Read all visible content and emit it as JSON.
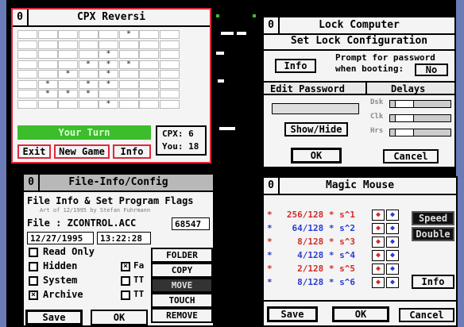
{
  "reversi": {
    "title": "CPX Reversi",
    "close": "0",
    "status": "Your Turn",
    "score_cpx": "CPX: 6",
    "score_you": "You: 18",
    "buttons": {
      "exit": "Exit",
      "new_game": "New Game",
      "info": "Info"
    },
    "board_rows": [
      [
        "",
        "",
        "",
        "",
        "",
        "*",
        "",
        ""
      ],
      [
        "",
        "",
        "",
        "",
        "",
        "",
        "",
        ""
      ],
      [
        "",
        "",
        "",
        "",
        "*",
        "",
        "",
        ""
      ],
      [
        "",
        "",
        "",
        "*",
        "*",
        "*",
        "",
        ""
      ],
      [
        "",
        "",
        "*",
        "",
        "*",
        "",
        "",
        ""
      ],
      [
        "",
        "*",
        "",
        "*",
        "*",
        "",
        "",
        ""
      ],
      [
        "",
        "*",
        "*",
        "*",
        "",
        "",
        "",
        ""
      ],
      [
        "",
        "",
        "",
        "",
        "*",
        "",
        "",
        ""
      ]
    ],
    "colors": {
      "status_bg": "#3cbd2c",
      "border": "#e0283c"
    }
  },
  "lock": {
    "title": "Lock Computer",
    "close": "0",
    "heading": "Set Lock Configuration",
    "info_button": "Info",
    "prompt_line1": "Prompt for password",
    "prompt_line2": "when booting:",
    "prompt_value": "No",
    "edit_password_label": "Edit Password",
    "delays_label": "Delays",
    "show_hide": "Show/Hide",
    "ok": "OK",
    "cancel": "Cancel",
    "delay_rows": [
      {
        "label": "Dsk"
      },
      {
        "label": "Clk"
      },
      {
        "label": "Hrs"
      }
    ]
  },
  "fileinfo": {
    "title": "File-Info/Config",
    "close": "0",
    "heading": "File Info & Set Program Flags",
    "subline": "Art of 12/1995 by Stefan Fuhrmann",
    "file_label": "File : ZCONTROL.ACC",
    "size": "68547",
    "date": "12/27/1995",
    "time": "13:22:28",
    "checks": [
      {
        "label": "Read Only",
        "checked": false
      },
      {
        "label": "Hidden",
        "checked": false
      },
      {
        "label": "System",
        "checked": false
      },
      {
        "label": "Archive",
        "checked": true
      }
    ],
    "right_checks": [
      {
        "label": "Fa",
        "checked": true
      },
      {
        "label": "TT",
        "checked": false
      },
      {
        "label": "TT",
        "checked": false
      }
    ],
    "menu": [
      "FOLDER",
      "COPY",
      "MOVE",
      "TOUCH",
      "REMOVE"
    ],
    "save": "Save",
    "ok": "OK"
  },
  "magic": {
    "title": "Magic Mouse",
    "close": "0",
    "rows": [
      {
        "ratio": "256/128",
        "exp": "s^1",
        "color": "#d42a2a"
      },
      {
        "ratio": "64/128",
        "exp": "s^2",
        "color": "#2a3ad4"
      },
      {
        "ratio": "8/128",
        "exp": "s^3",
        "color": "#d42a2a"
      },
      {
        "ratio": "4/128",
        "exp": "s^4",
        "color": "#2a3ad4"
      },
      {
        "ratio": "2/128",
        "exp": "s^5",
        "color": "#d42a2a"
      },
      {
        "ratio": "8/128",
        "exp": "s^6",
        "color": "#2a3ad4"
      }
    ],
    "star": "*",
    "times": "*",
    "speed": "Speed",
    "double": "Double",
    "info": "Info",
    "save": "Save",
    "ok": "OK",
    "cancel": "Cancel"
  }
}
